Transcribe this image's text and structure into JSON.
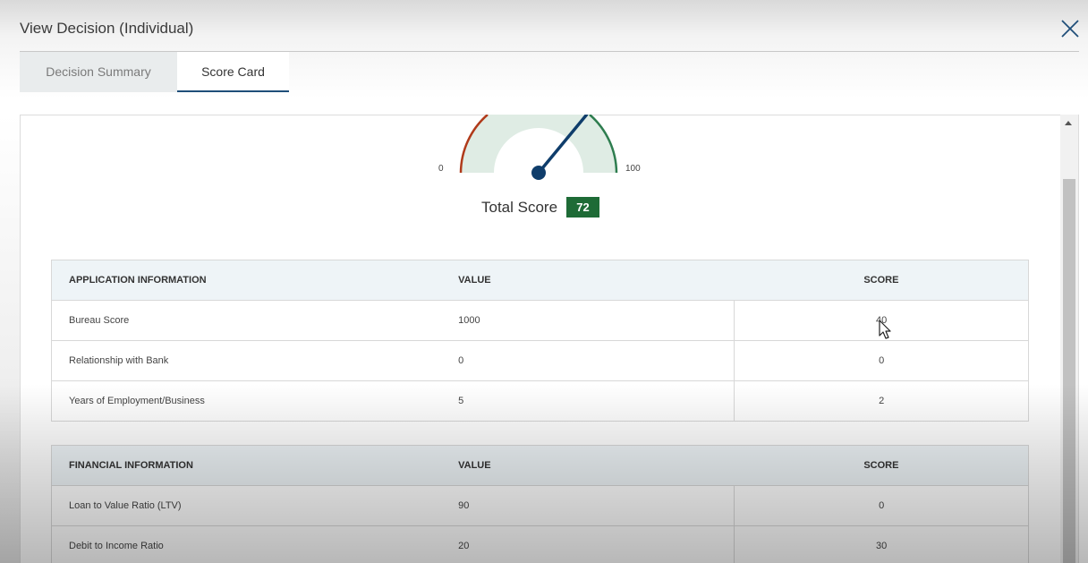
{
  "dialog": {
    "title": "View Decision (Individual)"
  },
  "tabs": [
    {
      "label": "Decision Summary",
      "active": false
    },
    {
      "label": "Score Card",
      "active": true
    }
  ],
  "gauge": {
    "min_label": "0",
    "max_label": "100",
    "value": 72
  },
  "total": {
    "label": "Total Score",
    "value": "72"
  },
  "application_table": {
    "headers": [
      "APPLICATION INFORMATION",
      "VALUE",
      "SCORE"
    ],
    "rows": [
      {
        "label": "Bureau Score",
        "value": "1000",
        "score": "40"
      },
      {
        "label": "Relationship with Bank",
        "value": "0",
        "score": "0"
      },
      {
        "label": "Years of Employment/Business",
        "value": "5",
        "score": "2"
      }
    ]
  },
  "financial_table": {
    "headers": [
      "FINANCIAL INFORMATION",
      "VALUE",
      "SCORE"
    ],
    "rows": [
      {
        "label": "Loan to Value Ratio (LTV)",
        "value": "90",
        "score": "0"
      },
      {
        "label": "Debit to Income Ratio",
        "value": "20",
        "score": "30"
      }
    ]
  },
  "colors": {
    "accent": "#1f4e79",
    "score_badge": "#1e6b36",
    "gauge_low": "#b03a1a",
    "gauge_high": "#2e7d4f",
    "gauge_fill": "#dfece4"
  },
  "icons": {
    "close": "close-icon",
    "scroll_up": "scroll-up-arrow-icon",
    "cursor": "mouse-pointer-icon"
  }
}
